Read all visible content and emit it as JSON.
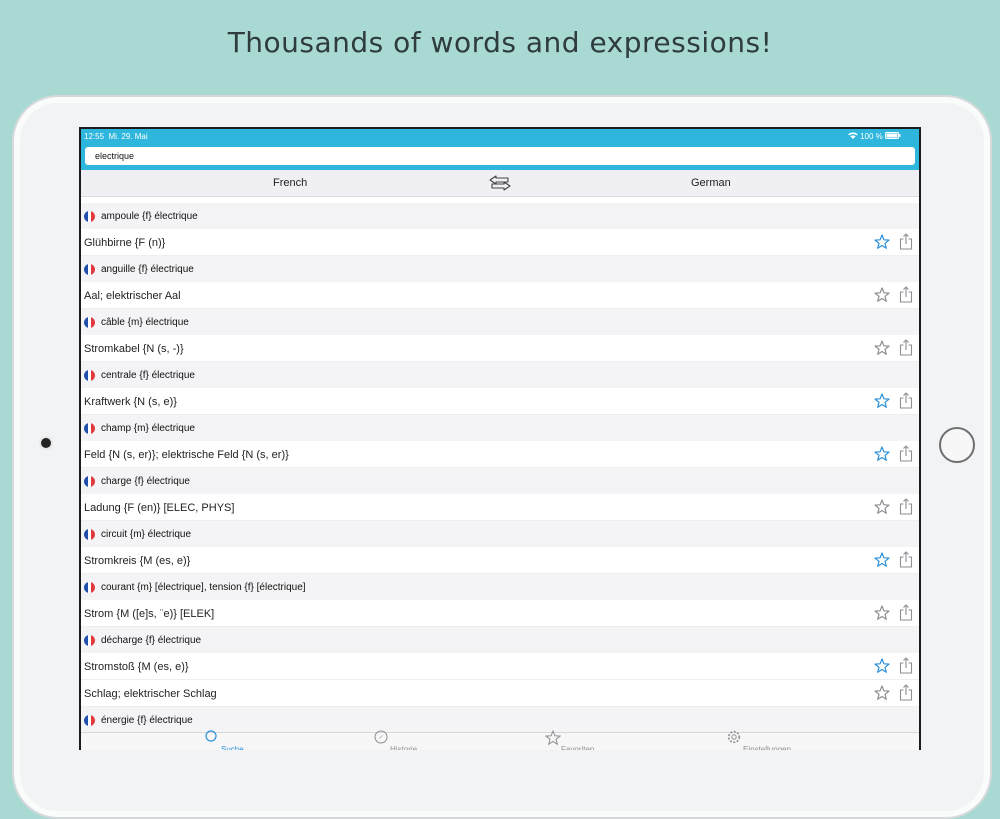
{
  "headline": "Thousands of words and expressions!",
  "status": {
    "time": "12:55",
    "date": "Mi. 29. Mai",
    "battery": "100 %"
  },
  "search": {
    "value": "electrique"
  },
  "languages": {
    "left": "French",
    "right": "German"
  },
  "colors": {
    "accent": "#2eb6dc",
    "star_active": "#2b90d9",
    "star_inactive": "#8e8e93",
    "background": "#a8dad3"
  },
  "entries": [
    {
      "fr": "ampoule {f} électrique",
      "de": [
        "Glühbirne {F (n)}"
      ],
      "fav": [
        true
      ]
    },
    {
      "fr": "anguille {f} électrique",
      "de": [
        "Aal; elektrischer Aal"
      ],
      "fav": [
        false
      ]
    },
    {
      "fr": "câble {m} électrique",
      "de": [
        "Stromkabel {N (s, -)}"
      ],
      "fav": [
        false
      ]
    },
    {
      "fr": "centrale {f} électrique",
      "de": [
        "Kraftwerk {N (s, e)}"
      ],
      "fav": [
        true
      ]
    },
    {
      "fr": "champ {m} électrique",
      "de": [
        "Feld {N (s, er)}; elektrische Feld {N (s, er)}"
      ],
      "fav": [
        true
      ]
    },
    {
      "fr": "charge {f} électrique",
      "de": [
        "Ladung {F (en)} [ELEC, PHYS]"
      ],
      "fav": [
        false
      ]
    },
    {
      "fr": "circuit {m} électrique",
      "de": [
        "Stromkreis {M (es, e)}"
      ],
      "fav": [
        true
      ]
    },
    {
      "fr": "courant {m} [électrique], tension {f} [électrique]",
      "de": [
        "Strom {M ([e]s, ¨e)} [ELEK]"
      ],
      "fav": [
        false
      ]
    },
    {
      "fr": "décharge {f} électrique",
      "de": [
        "Stromstoß {M (es, e)}",
        "Schlag; elektrischer Schlag"
      ],
      "fav": [
        true,
        false
      ]
    },
    {
      "fr": "énergie {f} électrique",
      "de": [],
      "fav": []
    }
  ],
  "tabs": [
    {
      "label": "Suche",
      "icon": "search-icon",
      "active": true
    },
    {
      "label": "Historie",
      "icon": "compass-icon",
      "active": false
    },
    {
      "label": "Favoriten",
      "icon": "star-icon",
      "active": false
    },
    {
      "label": "Einstellungen",
      "icon": "gear-icon",
      "active": false
    }
  ]
}
